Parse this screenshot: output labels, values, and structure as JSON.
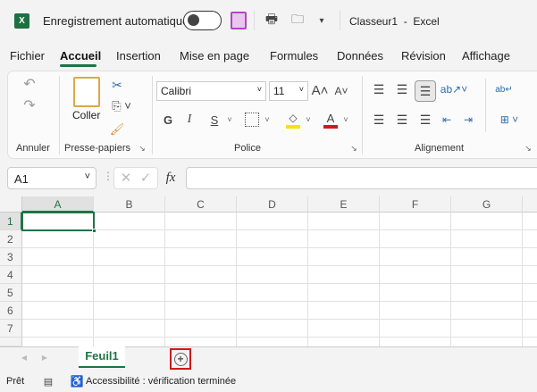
{
  "titlebar": {
    "autosave_label": "Enregistrement automatique",
    "autosave_on": false,
    "title": "Classeur1  -  Excel",
    "brand_color": "#217346"
  },
  "tabs": [
    {
      "label": "Fichier"
    },
    {
      "label": "Accueil",
      "active": true
    },
    {
      "label": "Insertion"
    },
    {
      "label": "Mise en page"
    },
    {
      "label": "Formules"
    },
    {
      "label": "Données"
    },
    {
      "label": "Révision"
    },
    {
      "label": "Affichage"
    }
  ],
  "ribbon": {
    "groups": {
      "undo": "Annuler",
      "clipboard": "Presse-papiers",
      "font": "Police",
      "alignment": "Alignement"
    },
    "paste_label": "Coller",
    "font_name": "Calibri",
    "font_size": "11",
    "bold": "G",
    "italic": "I",
    "underline": "S"
  },
  "formula_bar": {
    "name_box": "A1",
    "value": "",
    "fx": "fx"
  },
  "columns": [
    "A",
    "B",
    "C",
    "D",
    "E",
    "F",
    "G"
  ],
  "rows": [
    "1",
    "2",
    "3",
    "4",
    "5",
    "6",
    "7"
  ],
  "selected_cell": "A1",
  "sheets": [
    {
      "name": "Feuil1",
      "active": true
    }
  ],
  "status": {
    "ready": "Prêt",
    "accessibility": "Accessibilité : vérification terminée"
  }
}
